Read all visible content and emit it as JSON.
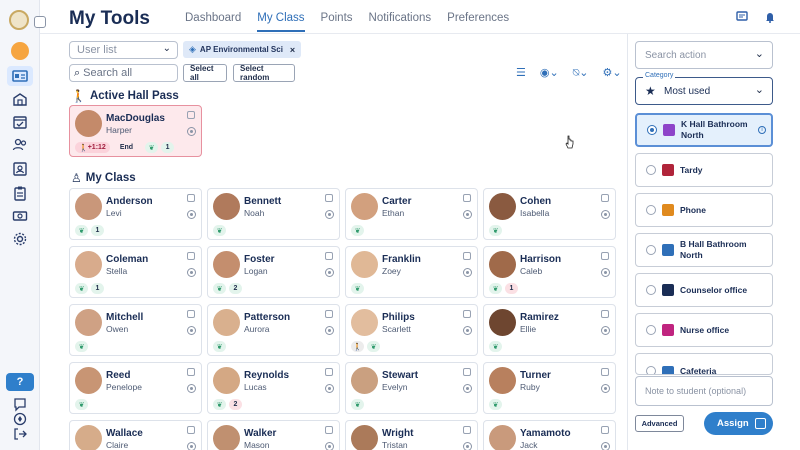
{
  "app": {
    "title": "My Tools",
    "tabs": [
      {
        "label": "Dashboard",
        "active": false
      },
      {
        "label": "My Class",
        "active": true
      },
      {
        "label": "Points",
        "active": false
      },
      {
        "label": "Notifications",
        "active": false
      },
      {
        "label": "Preferences",
        "active": false
      }
    ]
  },
  "toolbar": {
    "user_list_placeholder": "User list",
    "class_chip": "AP Environmental Sci",
    "search_placeholder": "Search all",
    "select_all": "Select all",
    "select_random": "Select random"
  },
  "hall_pass": {
    "title": "Active Hall Pass",
    "student": {
      "last": "MacDouglas",
      "first": "Harper",
      "timer": "+1:12",
      "end": "End",
      "count": "1"
    }
  },
  "my_class": {
    "title": "My Class",
    "students": [
      {
        "last": "Anderson",
        "first": "Levi",
        "count": "1",
        "walk": false,
        "red": false
      },
      {
        "last": "Bennett",
        "first": "Noah",
        "count": "",
        "walk": false,
        "red": false
      },
      {
        "last": "Carter",
        "first": "Ethan",
        "count": "",
        "walk": false,
        "red": false
      },
      {
        "last": "Cohen",
        "first": "Isabella",
        "count": "",
        "walk": false,
        "red": false
      },
      {
        "last": "Coleman",
        "first": "Stella",
        "count": "1",
        "walk": false,
        "red": false
      },
      {
        "last": "Foster",
        "first": "Logan",
        "count": "2",
        "walk": false,
        "red": false
      },
      {
        "last": "Franklin",
        "first": "Zoey",
        "count": "",
        "walk": false,
        "red": false
      },
      {
        "last": "Harrison",
        "first": "Caleb",
        "count": "1",
        "walk": false,
        "red": true
      },
      {
        "last": "Mitchell",
        "first": "Owen",
        "count": "",
        "walk": false,
        "red": false
      },
      {
        "last": "Patterson",
        "first": "Aurora",
        "count": "",
        "walk": false,
        "red": false
      },
      {
        "last": "Philips",
        "first": "Scarlett",
        "count": "",
        "walk": true,
        "red": false
      },
      {
        "last": "Ramirez",
        "first": "Ellie",
        "count": "",
        "walk": false,
        "red": false
      },
      {
        "last": "Reed",
        "first": "Penelope",
        "count": "",
        "walk": false,
        "red": false
      },
      {
        "last": "Reynolds",
        "first": "Lucas",
        "count": "2",
        "walk": false,
        "red": true
      },
      {
        "last": "Stewart",
        "first": "Evelyn",
        "count": "",
        "walk": false,
        "red": false
      },
      {
        "last": "Turner",
        "first": "Ruby",
        "count": "",
        "walk": false,
        "red": false
      },
      {
        "last": "Wallace",
        "first": "Claire",
        "count": "",
        "walk": false,
        "red": false
      },
      {
        "last": "Walker",
        "first": "Mason",
        "count": "",
        "walk": false,
        "red": false
      },
      {
        "last": "Wright",
        "first": "Tristan",
        "count": "",
        "walk": false,
        "red": false
      },
      {
        "last": "Yamamoto",
        "first": "Jack",
        "count": "",
        "walk": false,
        "red": false
      }
    ]
  },
  "actions": {
    "search_placeholder": "Search action",
    "category_label": "Category",
    "category_value": "Most used",
    "items": [
      {
        "label": "K Hall Bathroom North",
        "selected": true,
        "color": "#8e44c9",
        "info": "i"
      },
      {
        "label": "Tardy",
        "selected": false,
        "color": "#b0243a",
        "info": ""
      },
      {
        "label": "Phone",
        "selected": false,
        "color": "#e08a1e",
        "info": ""
      },
      {
        "label": "B Hall Bathroom North",
        "selected": false,
        "color": "#2f6fb8",
        "info": ""
      },
      {
        "label": "Counselor office",
        "selected": false,
        "color": "#1a2d55",
        "info": ""
      },
      {
        "label": "Nurse office",
        "selected": false,
        "color": "#c0247f",
        "info": ""
      },
      {
        "label": "Cafeteria",
        "selected": false,
        "color": "#2f6fb8",
        "info": ""
      }
    ],
    "note_placeholder": "Note to student (optional)",
    "advanced": "Advanced",
    "assign": "Assign"
  },
  "colors": {
    "accent": "#2f7fcb",
    "navy": "#1a2d55",
    "hall_bg": "#fde9ec"
  }
}
